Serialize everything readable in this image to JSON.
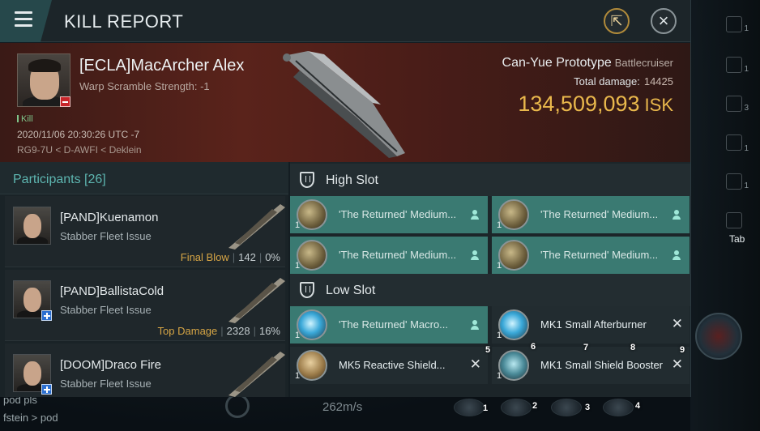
{
  "window": {
    "title": "KILL REPORT"
  },
  "victim": {
    "name": "[ECLA]MacArcher Alex",
    "warp_scramble": "Warp Scramble Strength: -1",
    "kill_tag": "Kill",
    "datetime": "2020/11/06 20:30:26 UTC -7",
    "location": "RG9-7U < D-AWFI < Deklein",
    "ship_name": "Can-Yue Prototype",
    "ship_class": "Battlecruiser",
    "total_damage_label": "Total damage:",
    "total_damage": "14425",
    "isk_value": "134,509,093",
    "isk_unit": "ISK"
  },
  "participants": {
    "title": "Participants [26]",
    "items": [
      {
        "name": "[PAND]Kuenamon",
        "ship": "Stabber Fleet Issue",
        "tag": "Final Blow",
        "damage": "142",
        "percent": "0%"
      },
      {
        "name": "[PAND]BallistaCold",
        "ship": "Stabber Fleet Issue",
        "tag": "Top Damage",
        "damage": "2328",
        "percent": "16%"
      },
      {
        "name": "[DOOM]Draco Fire",
        "ship": "Stabber Fleet Issue",
        "tag": "",
        "damage": "",
        "percent": ""
      }
    ]
  },
  "fitting": {
    "high_slot": {
      "title": "High Slot",
      "modules": [
        {
          "name": "'The Returned' Medium...",
          "qty": "1"
        },
        {
          "name": "'The Returned' Medium...",
          "qty": "1"
        },
        {
          "name": "'The Returned' Medium...",
          "qty": "1"
        },
        {
          "name": "'The Returned' Medium...",
          "qty": "1"
        }
      ]
    },
    "low_slot": {
      "title": "Low Slot",
      "modules": [
        {
          "name": "'The Returned' Macro...",
          "qty": "1"
        },
        {
          "name": "MK1 Small Afterburner",
          "qty": "1"
        },
        {
          "name": "MK5 Reactive Shield...",
          "qty": "1"
        },
        {
          "name": "MK1 Small Shield Booster",
          "qty": "1"
        }
      ]
    }
  },
  "hud": {
    "tab_label": "Tab",
    "speed": "262m/s",
    "chat_lines": [
      "pod pls",
      "fstein > pod"
    ],
    "slot_numbers": [
      "1",
      "2",
      "3",
      "4",
      "5",
      "6",
      "7",
      "8",
      "9"
    ],
    "side_numbers": [
      "1",
      "1",
      "3",
      "1",
      "1"
    ]
  },
  "colors": {
    "accent_teal": "#3a7a72",
    "isk_gold": "#e9b84c",
    "kill_green": "#7fc48a",
    "header_red": "#5a231b"
  },
  "icons": {
    "menu": "hamburger-icon",
    "share": "share-icon",
    "close": "close-icon",
    "slot": "shield-icon",
    "owner": "person-icon",
    "destroyed": "x-icon"
  }
}
